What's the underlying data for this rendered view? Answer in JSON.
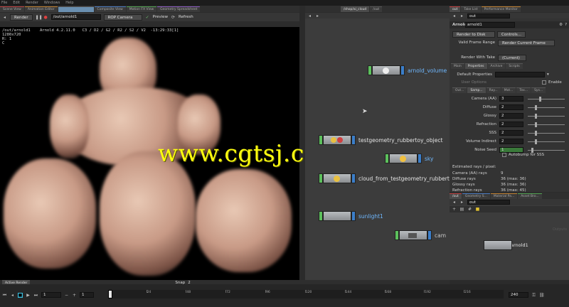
{
  "menubar": [
    "File",
    "Edit",
    "Render",
    "Windows",
    "Help",
    "Assets",
    "Desktop",
    "Help",
    "Build",
    "Arnold"
  ],
  "top_tabs_left": [
    "Scene View",
    "Animation Editor",
    "",
    "Composite View",
    "Motion FX View",
    "Geometry Spreadsheet"
  ],
  "top_tabs_mid": [
    "/shop/ai_cloud",
    "/out"
  ],
  "top_tabs_right": [
    "out",
    "Take List",
    "Performance Monitor"
  ],
  "render_toolbar": {
    "render_label": "Render",
    "path": "/out/arnold1",
    "camera_label": "ROP Camera",
    "preview_label": "Preview",
    "refresh_label": "Refresh"
  },
  "viewport": {
    "info_line1": "/out/arnold1    Arnold 4.2.11.0   C3 / D2 / G2 / R2 / S2 / V2  -13:29:33[1]",
    "info_line2": "1280x720",
    "info_line3": "R: 1",
    "info_line4": "C"
  },
  "watermark": "www.cgtsj.com",
  "network": {
    "path": "out",
    "nodes": [
      {
        "label": "arnold_volume",
        "style": "blue"
      },
      {
        "label": "testgeometry_rubbertoy_object",
        "style": "white"
      },
      {
        "label": "sky",
        "style": "blue"
      },
      {
        "label": "cloud_from_testgeometry_rubbertoy",
        "style": "white"
      },
      {
        "label": "sunlight1",
        "style": "blue"
      },
      {
        "label": "cam",
        "style": "white"
      }
    ]
  },
  "params": {
    "header_type": "Arnold",
    "header_name": "arnold1",
    "top_tabs": [
      "Render to Disk",
      "Controls..."
    ],
    "valid_frame_range_label": "Valid Frame Range",
    "valid_frame_range_value": "Render Current Frame",
    "render_with_take_label": "Render With Take",
    "render_with_take_value": "(Current)",
    "main_tabs": [
      "Main",
      "Properties",
      "Archive",
      "Scripts"
    ],
    "default_properties_label": "Default Properties",
    "user_options_label": "User Options",
    "enable_label": "Enable",
    "sub_tabs": [
      "Out...",
      "Samp...",
      "Ray...",
      "Mot...",
      "Tex...",
      "Sys..."
    ],
    "samples": [
      {
        "label": "Camera (AA)",
        "value": "3",
        "slider": 0.3
      },
      {
        "label": "Diffuse",
        "value": "2",
        "slider": 0.2
      },
      {
        "label": "Glossy",
        "value": "2",
        "slider": 0.2
      },
      {
        "label": "Refraction",
        "value": "2",
        "slider": 0.2
      },
      {
        "label": "SSS",
        "value": "2",
        "slider": 0.2
      },
      {
        "label": "Volume Indirect",
        "value": "2",
        "slider": 0.2
      },
      {
        "label": "Noise Seed",
        "value": "1",
        "slider": 0.1
      }
    ],
    "autobump_label": "Autobump for SSS",
    "estimated_title": "Estimated rays / pixel:",
    "estimates": [
      {
        "label": "Camera (AA) rays",
        "value": "9"
      },
      {
        "label": "Diffuse rays",
        "value": "36 (max: 36)"
      },
      {
        "label": "Glossy rays",
        "value": "36 (max: 36)"
      },
      {
        "label": "Refraction rays",
        "value": "36 (max: 45)"
      }
    ]
  },
  "lower_panel": {
    "tabs": [
      "/out",
      "Geometry S...",
      "Material Pa...",
      "Asset Bro..."
    ],
    "path": "out",
    "node_label": "arnold1",
    "corner_text": "Outputs"
  },
  "bottom_bar": {
    "active_render_label": "Active Render",
    "snap_label": "Snap",
    "snap_value": "2"
  },
  "timeline": {
    "frame": "1",
    "start": "1",
    "end_value": "240",
    "ticks": [
      "1",
      "24",
      "48",
      "72",
      "96",
      "120",
      "144",
      "168",
      "192",
      "216"
    ]
  },
  "colors": {
    "accent_green": "#5cc05c",
    "accent_blue": "#3b7ec9",
    "watermark": "#ffff10"
  }
}
